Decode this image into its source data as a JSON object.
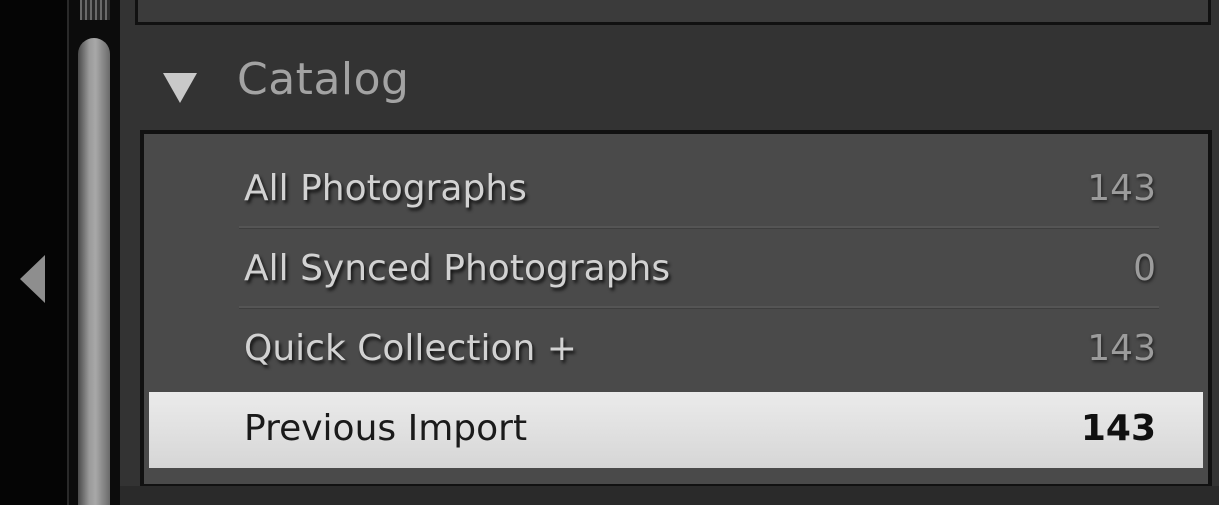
{
  "catalog": {
    "title": "Catalog",
    "items": [
      {
        "label": "All Photographs",
        "count": "143"
      },
      {
        "label": "All Synced Photographs",
        "count": "0"
      },
      {
        "label": "Quick Collection +",
        "count": "143"
      },
      {
        "label": "Previous Import",
        "count": "143",
        "selected": true
      }
    ]
  },
  "colors": {
    "panel_background": "#333333",
    "list_background": "#4a4a4a",
    "selected_row": "#e0e0e0",
    "text_light": "#d2d2d2",
    "text_count": "#9c9c9c"
  },
  "icons": {
    "disclosure": "triangle-down-icon",
    "collapse": "triangle-left-icon"
  }
}
